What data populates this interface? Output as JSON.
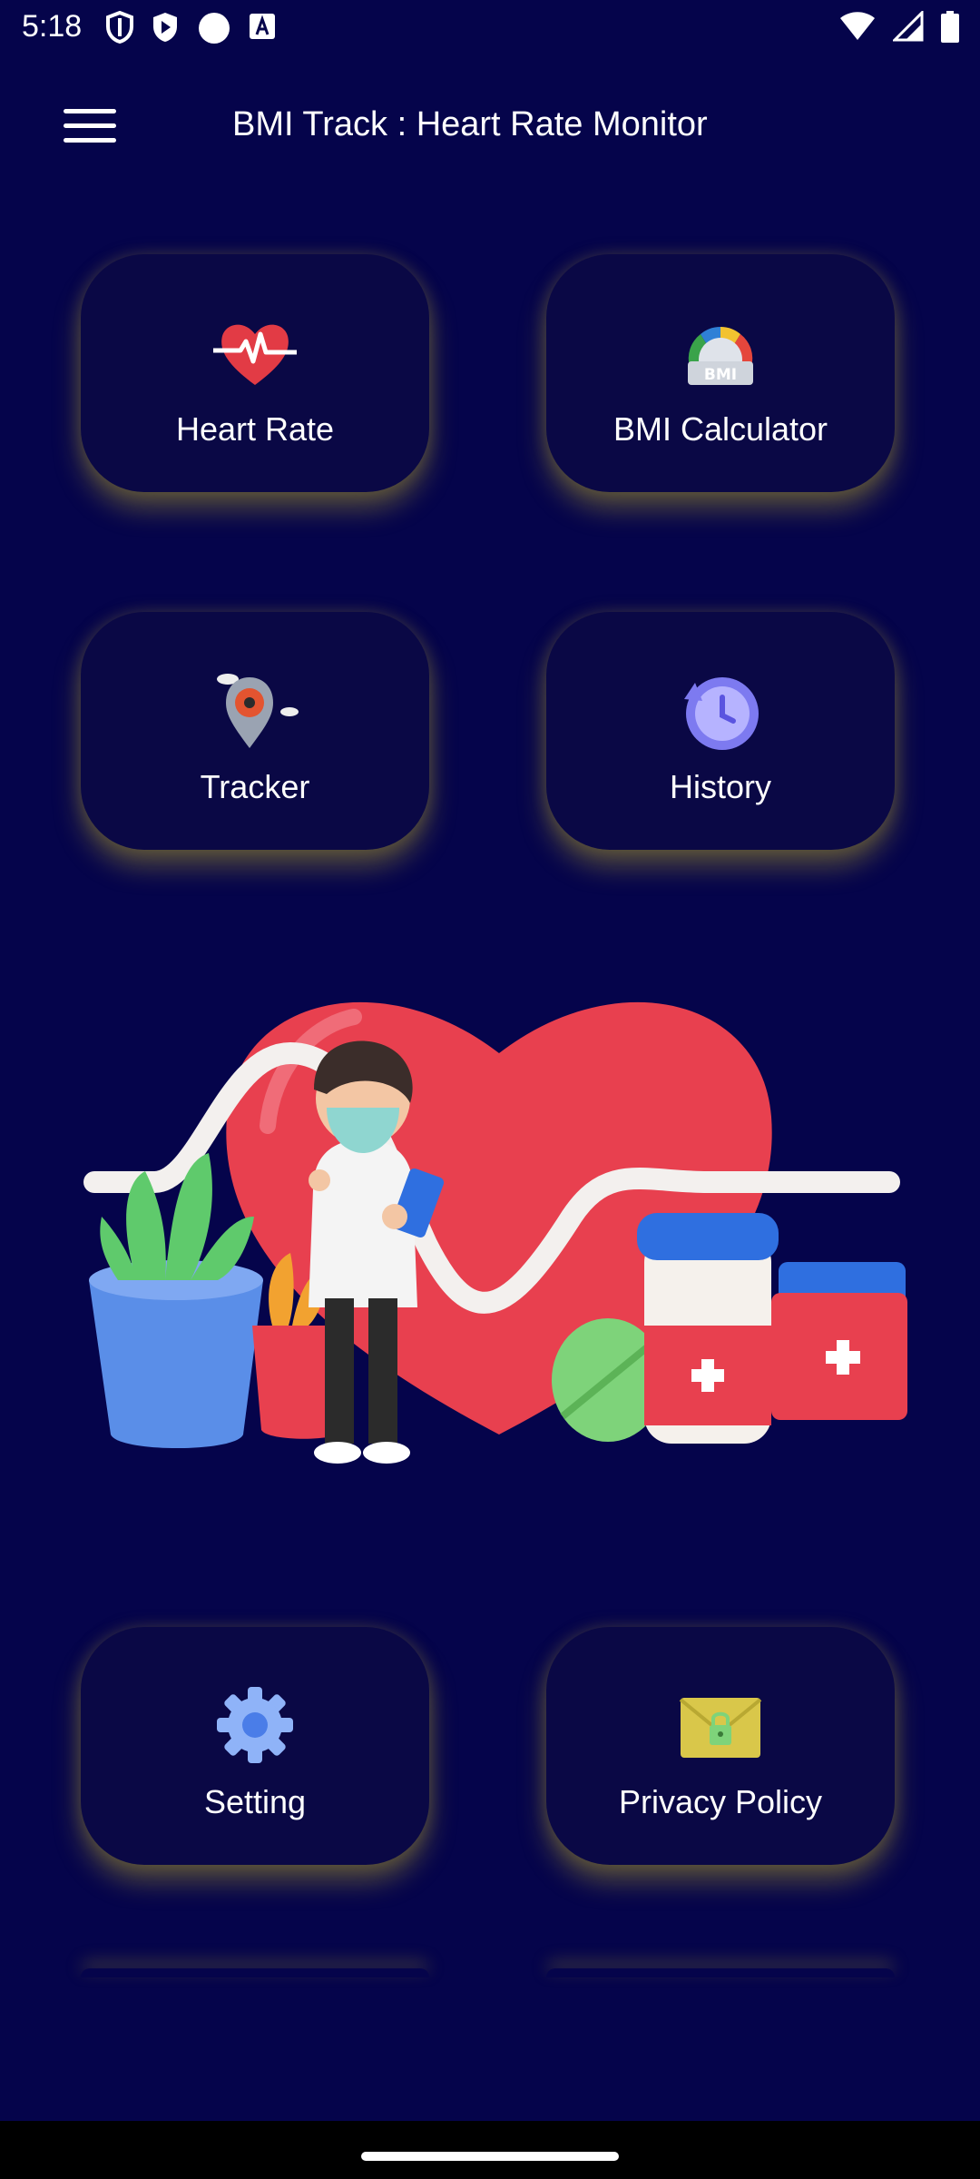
{
  "status_bar": {
    "time": "5:18"
  },
  "app_bar": {
    "title": "BMI Track : Heart Rate Monitor"
  },
  "cards": {
    "heart_rate": {
      "label": "Heart Rate",
      "icon": "heart-rate-icon"
    },
    "bmi_calculator": {
      "label": "BMI Calculator",
      "icon": "bmi-gauge-icon",
      "icon_text": "BMI"
    },
    "tracker": {
      "label": "Tracker",
      "icon": "location-pin-icon"
    },
    "history": {
      "label": "History",
      "icon": "history-clock-icon"
    },
    "setting": {
      "label": "Setting",
      "icon": "gear-icon"
    },
    "privacy_policy": {
      "label": "Privacy Policy",
      "icon": "lock-envelope-icon"
    }
  },
  "colors": {
    "background": "#05044b",
    "card": "#0a0845",
    "glow": "#afa028",
    "heart": "#e8404f",
    "accent_blue": "#5b8cf0"
  }
}
